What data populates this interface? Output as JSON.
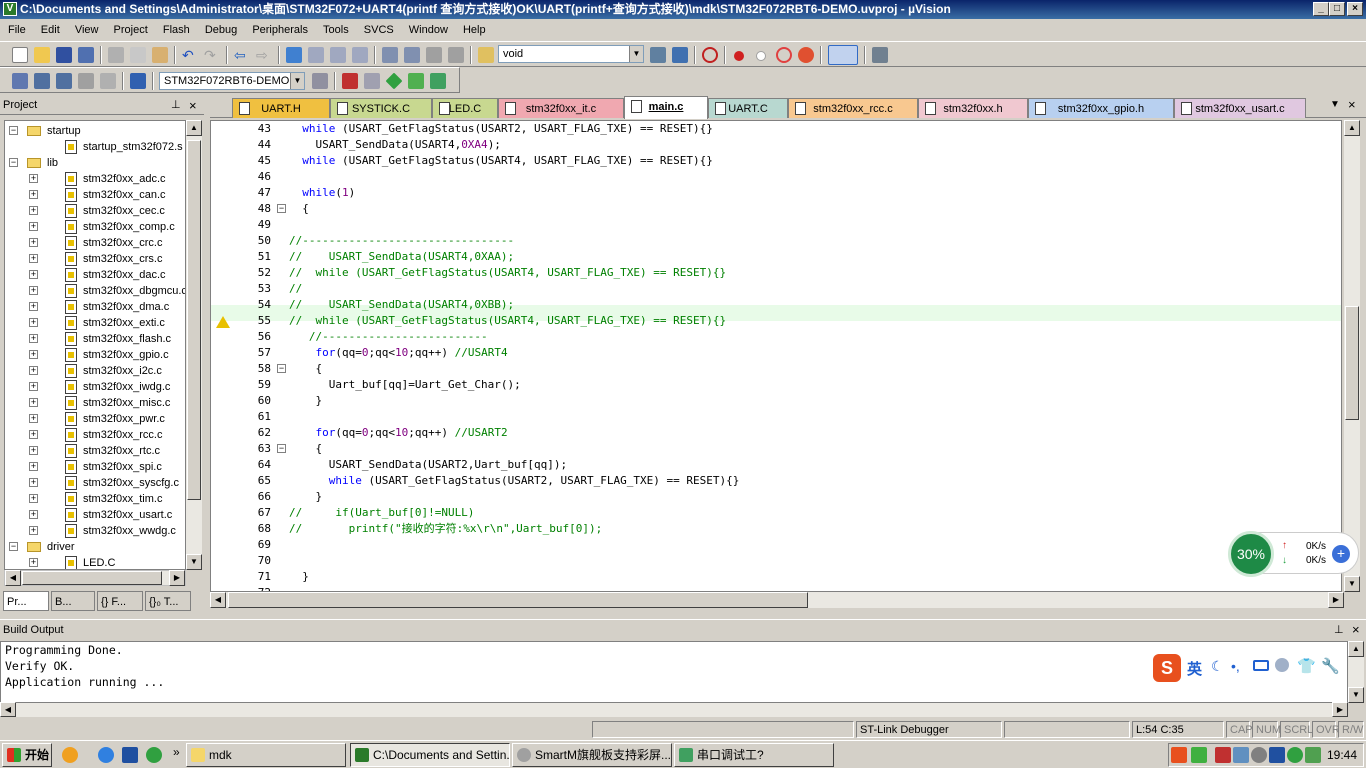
{
  "window": {
    "title": "C:\\Documents and Settings\\Administrator\\桌面\\STM32F072+UART4(printf 查询方式接收)OK\\UART(printf+查询方式接收)\\mdk\\STM32F072RBT6-DEMO.uvproj - µVision",
    "min": "_",
    "max": "□",
    "close": "×"
  },
  "menu": [
    "File",
    "Edit",
    "View",
    "Project",
    "Flash",
    "Debug",
    "Peripherals",
    "Tools",
    "SVCS",
    "Window",
    "Help"
  ],
  "toolbar": {
    "find_value": "void",
    "target": "STM32F072RBT6-DEMO"
  },
  "project": {
    "title": "Project",
    "pin": "ᵖ",
    "close": "×",
    "tree": [
      {
        "label": "startup",
        "type": "folder",
        "level": 1,
        "exp": "−"
      },
      {
        "label": "startup_stm32f072.s",
        "type": "file",
        "level": 2
      },
      {
        "label": "lib",
        "type": "folder",
        "level": 1,
        "exp": "−"
      },
      {
        "label": "stm32f0xx_adc.c",
        "type": "file",
        "level": 2,
        "exp": "+"
      },
      {
        "label": "stm32f0xx_can.c",
        "type": "file",
        "level": 2,
        "exp": "+"
      },
      {
        "label": "stm32f0xx_cec.c",
        "type": "file",
        "level": 2,
        "exp": "+"
      },
      {
        "label": "stm32f0xx_comp.c",
        "type": "file",
        "level": 2,
        "exp": "+"
      },
      {
        "label": "stm32f0xx_crc.c",
        "type": "file",
        "level": 2,
        "exp": "+"
      },
      {
        "label": "stm32f0xx_crs.c",
        "type": "file",
        "level": 2,
        "exp": "+"
      },
      {
        "label": "stm32f0xx_dac.c",
        "type": "file",
        "level": 2,
        "exp": "+"
      },
      {
        "label": "stm32f0xx_dbgmcu.c",
        "type": "file",
        "level": 2,
        "exp": "+"
      },
      {
        "label": "stm32f0xx_dma.c",
        "type": "file",
        "level": 2,
        "exp": "+"
      },
      {
        "label": "stm32f0xx_exti.c",
        "type": "file",
        "level": 2,
        "exp": "+"
      },
      {
        "label": "stm32f0xx_flash.c",
        "type": "file",
        "level": 2,
        "exp": "+"
      },
      {
        "label": "stm32f0xx_gpio.c",
        "type": "file",
        "level": 2,
        "exp": "+"
      },
      {
        "label": "stm32f0xx_i2c.c",
        "type": "file",
        "level": 2,
        "exp": "+"
      },
      {
        "label": "stm32f0xx_iwdg.c",
        "type": "file",
        "level": 2,
        "exp": "+"
      },
      {
        "label": "stm32f0xx_misc.c",
        "type": "file",
        "level": 2,
        "exp": "+"
      },
      {
        "label": "stm32f0xx_pwr.c",
        "type": "file",
        "level": 2,
        "exp": "+"
      },
      {
        "label": "stm32f0xx_rcc.c",
        "type": "file",
        "level": 2,
        "exp": "+"
      },
      {
        "label": "stm32f0xx_rtc.c",
        "type": "file",
        "level": 2,
        "exp": "+"
      },
      {
        "label": "stm32f0xx_spi.c",
        "type": "file",
        "level": 2,
        "exp": "+"
      },
      {
        "label": "stm32f0xx_syscfg.c",
        "type": "file",
        "level": 2,
        "exp": "+"
      },
      {
        "label": "stm32f0xx_tim.c",
        "type": "file",
        "level": 2,
        "exp": "+"
      },
      {
        "label": "stm32f0xx_usart.c",
        "type": "file",
        "level": 2,
        "exp": "+"
      },
      {
        "label": "stm32f0xx_wwdg.c",
        "type": "file",
        "level": 2,
        "exp": "+"
      },
      {
        "label": "driver",
        "type": "folder",
        "level": 1,
        "exp": "−"
      },
      {
        "label": "LED.C",
        "type": "file",
        "level": 2,
        "exp": "+"
      }
    ],
    "tabs": [
      "Pr...",
      "B...",
      "{} F...",
      "{}₀ T..."
    ]
  },
  "editor_tabs": [
    {
      "label": "UART.H",
      "color": "#f0c040"
    },
    {
      "label": "SYSTICK.C",
      "color": "#c8d890"
    },
    {
      "label": "LED.C",
      "color": "#c8d890"
    },
    {
      "label": "stm32f0xx_it.c",
      "color": "#f0a8b0"
    },
    {
      "label": "main.c",
      "color": "#ffffff"
    },
    {
      "label": "UART.C",
      "color": "#b8d8d0"
    },
    {
      "label": "stm32f0xx_rcc.c",
      "color": "#f8c890"
    },
    {
      "label": "stm32f0xx.h",
      "color": "#f0c8d0"
    },
    {
      "label": "stm32f0xx_gpio.h",
      "color": "#b8d0f0"
    },
    {
      "label": "stm32f0xx_usart.c",
      "color": "#e0c8e0"
    }
  ],
  "code": [
    {
      "n": "43",
      "t": "  while (USART_GetFlagStatus(USART2, USART_FLAG_TXE) == RESET){}"
    },
    {
      "n": "44",
      "t": "    USART_SendData(USART4,0XA4);"
    },
    {
      "n": "45",
      "t": "  while (USART_GetFlagStatus(USART4, USART_FLAG_TXE) == RESET){}"
    },
    {
      "n": "46",
      "t": ""
    },
    {
      "n": "47",
      "t": "  while(1)"
    },
    {
      "n": "48",
      "t": "  {"
    },
    {
      "n": "49",
      "t": ""
    },
    {
      "n": "50",
      "t": "//--------------------------------"
    },
    {
      "n": "51",
      "t": "//    USART_SendData(USART4,0XAA);"
    },
    {
      "n": "52",
      "t": "//  while (USART_GetFlagStatus(USART4, USART_FLAG_TXE) == RESET){}"
    },
    {
      "n": "53",
      "t": "//"
    },
    {
      "n": "54",
      "t": "//    USART_SendData(USART4,0XBB);"
    },
    {
      "n": "55",
      "t": "//  while (USART_GetFlagStatus(USART4, USART_FLAG_TXE) == RESET){}"
    },
    {
      "n": "56",
      "t": "   //-------------------------"
    },
    {
      "n": "57",
      "t": "    for(qq=0;qq<10;qq++) //USART4"
    },
    {
      "n": "58",
      "t": "    {"
    },
    {
      "n": "59",
      "t": "      Uart_buf[qq]=Uart_Get_Char();"
    },
    {
      "n": "60",
      "t": "    }"
    },
    {
      "n": "61",
      "t": ""
    },
    {
      "n": "62",
      "t": "    for(qq=0;qq<10;qq++) //USART2"
    },
    {
      "n": "63",
      "t": "    {"
    },
    {
      "n": "64",
      "t": "      USART_SendData(USART2,Uart_buf[qq]);"
    },
    {
      "n": "65",
      "t": "      while (USART_GetFlagStatus(USART2, USART_FLAG_TXE) == RESET){}"
    },
    {
      "n": "66",
      "t": "    }"
    },
    {
      "n": "67",
      "t": "//     if(Uart_buf[0]!=NULL)"
    },
    {
      "n": "68",
      "t": "//       printf(\"接收的字符:%x\\r\\n\",Uart_buf[0]);"
    },
    {
      "n": "69",
      "t": ""
    },
    {
      "n": "70",
      "t": ""
    },
    {
      "n": "71",
      "t": "  }"
    },
    {
      "n": "72",
      "t": ""
    }
  ],
  "build": {
    "title": "Build Output",
    "lines": [
      "Programming Done.",
      "Verify OK.",
      "Application running ..."
    ]
  },
  "status": {
    "debugger": "ST-Link Debugger",
    "position": "L:54 C:35",
    "cap": "CAP",
    "num": "NUM",
    "scrl": "SCRL",
    "ovr": "OVR",
    "rw": "R/W"
  },
  "netwidget": {
    "percent": "30%",
    "up": "0K/s",
    "down": "0K/s"
  },
  "ime": {
    "lang": "英"
  },
  "taskbar": {
    "start": "开始",
    "items": [
      "mdk",
      "C:\\Documents and Settin...",
      "SmartM旗舰板支持彩屏...",
      "串口调试工?"
    ],
    "clock": "19:44"
  }
}
